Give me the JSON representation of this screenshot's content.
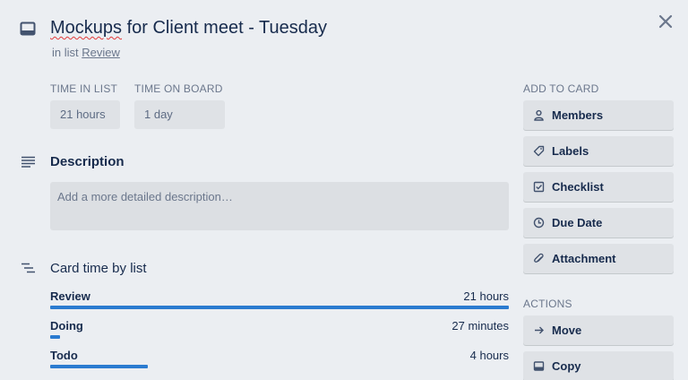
{
  "card": {
    "title_word1": "Mockups",
    "title_rest": " for Client meet - Tuesday",
    "in_list_prefix": "in list ",
    "list_name": "Review"
  },
  "time": {
    "in_list_label": "TIME IN LIST",
    "in_list_value": "21 hours",
    "on_board_label": "TIME ON BOARD",
    "on_board_value": "1 day"
  },
  "description": {
    "heading": "Description",
    "placeholder": "Add a more detailed description…"
  },
  "card_time": {
    "heading": "Card time by list",
    "rows": [
      {
        "name": "Review",
        "duration": "21 hours",
        "fraction": 1.0
      },
      {
        "name": "Doing",
        "duration": "27 minutes",
        "fraction": 0.021
      },
      {
        "name": "Todo",
        "duration": "4 hours",
        "fraction": 0.213
      }
    ]
  },
  "sidebar": {
    "add_label": "ADD TO CARD",
    "add_buttons": [
      {
        "label": "Members",
        "icon": "person-icon"
      },
      {
        "label": "Labels",
        "icon": "tag-icon"
      },
      {
        "label": "Checklist",
        "icon": "checkbox-icon"
      },
      {
        "label": "Due Date",
        "icon": "clock-icon"
      },
      {
        "label": "Attachment",
        "icon": "paperclip-icon"
      }
    ],
    "actions_label": "ACTIONS",
    "action_buttons": [
      {
        "label": "Move",
        "icon": "arrow-right-icon"
      },
      {
        "label": "Copy",
        "icon": "card-icon"
      }
    ]
  },
  "colors": {
    "accent_bar": "#2b7bd0",
    "background": "#ebeef2"
  }
}
